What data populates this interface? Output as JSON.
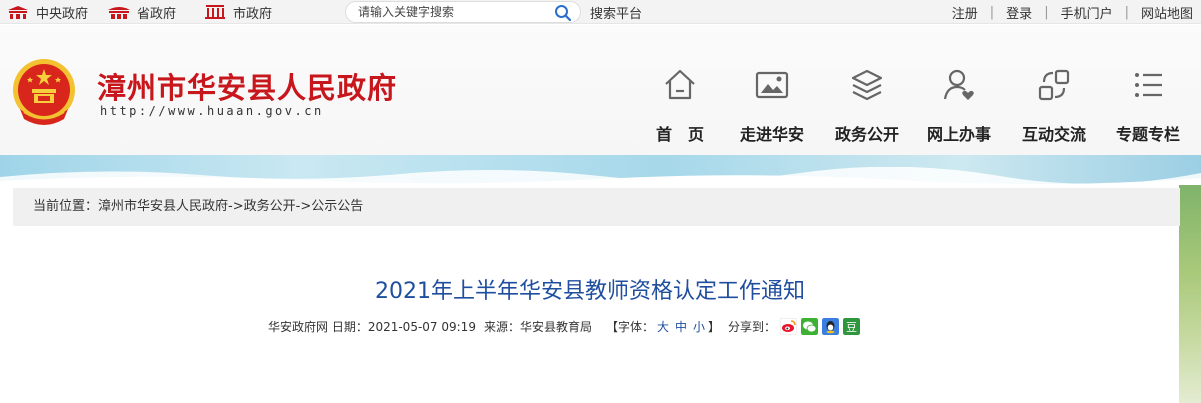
{
  "topbar": {
    "gov_links": [
      "中央政府",
      "省政府",
      "市政府"
    ],
    "search_placeholder": "请输入关键字搜索",
    "search_platform": "搜索平台",
    "right_links": [
      "注册",
      "登录",
      "手机门户",
      "网站地图"
    ]
  },
  "header": {
    "title": "漳州市华安县人民政府",
    "url": "http://www.huaan.gov.cn"
  },
  "nav": [
    {
      "label": "首　页",
      "icon": "home-icon"
    },
    {
      "label": "走进华安",
      "icon": "picture-icon"
    },
    {
      "label": "政务公开",
      "icon": "layers-icon"
    },
    {
      "label": "网上办事",
      "icon": "user-heart-icon"
    },
    {
      "label": "互动交流",
      "icon": "exchange-icon"
    },
    {
      "label": "专题专栏",
      "icon": "list-icon"
    }
  ],
  "breadcrumb": {
    "prefix": "当前位置：",
    "items": [
      "漳州市华安县人民政府",
      "政务公开",
      "公示公告"
    ],
    "separator": "->"
  },
  "article": {
    "title": "2021年上半年华安县教师资格认定工作通知",
    "meta_site": "华安政府网 日期：2021-05-07 09:19",
    "meta_source": "来源：华安县教育局",
    "font_label_open": "【字体：",
    "font_sizes": [
      "大",
      "中",
      "小"
    ],
    "font_label_close": "】",
    "share_label": "分享到："
  },
  "share_icons": [
    "weibo-icon",
    "wechat-icon",
    "qq-icon",
    "douban-icon"
  ],
  "colors": {
    "title_red": "#c8161d",
    "link_blue": "#1f4e9e",
    "crumb_bg": "#f0f0f0"
  }
}
